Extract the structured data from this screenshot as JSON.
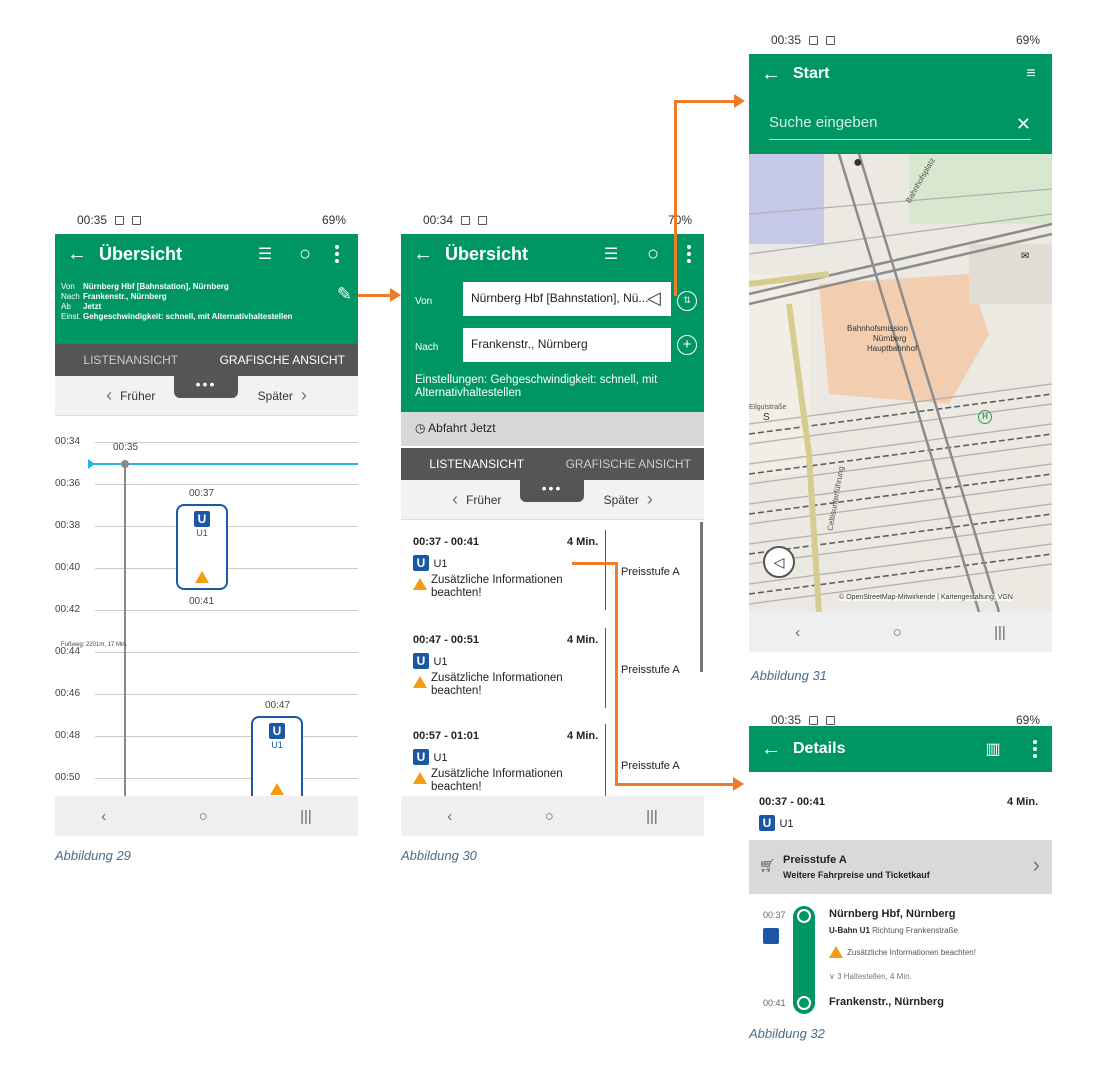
{
  "status": {
    "p29_time": "00:35",
    "p29_right": "69%",
    "p30_time": "00:34",
    "p30_right": "70%",
    "p31_time": "00:35",
    "p31_right": "69%",
    "p32_time": "00:35",
    "p32_right": "69%"
  },
  "p29": {
    "title": "Übersicht",
    "info": [
      {
        "k": "Von",
        "v": "Nürnberg Hbf [Bahnstation], Nürnberg"
      },
      {
        "k": "Nach",
        "v": "Frankenstr., Nürnberg"
      },
      {
        "k": "Ab",
        "v": "Jetzt"
      },
      {
        "k": "Einst.",
        "v": "Gehgeschwindigkeit: schnell, mit Alternativhaltestellen"
      }
    ],
    "tab_list": "LISTENANSICHT",
    "tab_graph": "GRAFISCHE ANSICHT",
    "earlier": "Früher",
    "later": "Später",
    "more": "•••",
    "times": [
      "00:34",
      "00:36",
      "00:38",
      "00:40",
      "00:42",
      "00:44",
      "00:46",
      "00:48",
      "00:50"
    ],
    "now": "00:35",
    "walk": "Fußweg: 2201m, 17 Min.",
    "trip1": {
      "start": "00:37",
      "end": "00:41",
      "line": "U1"
    },
    "trip2": {
      "start": "00:47",
      "line": "U1"
    }
  },
  "p30": {
    "title": "Übersicht",
    "from_label": "Von",
    "from_value": "Nürnberg Hbf [Bahnstation], Nü...",
    "to_label": "Nach",
    "to_value": "Frankenstr., Nürnberg",
    "settings": "Einstellungen: Gehgeschwindigkeit: schnell, mit Alternativhaltestellen",
    "departure": "Abfahrt Jetzt",
    "tab_list": "LISTENANSICHT",
    "tab_graph": "GRAFISCHE ANSICHT",
    "earlier": "Früher",
    "later": "Später",
    "more": "•••",
    "trips": [
      {
        "time": "00:37 - 00:41",
        "dur": "4 Min.",
        "line": "U1",
        "note": "Zusätzliche Informationen beachten!",
        "price": "Preisstufe A"
      },
      {
        "time": "00:47 - 00:51",
        "dur": "4 Min.",
        "line": "U1",
        "note": "Zusätzliche Informationen beachten!",
        "price": "Preisstufe A"
      },
      {
        "time": "00:57 - 01:01",
        "dur": "4 Min.",
        "line": "U1",
        "note": "Zusätzliche Informationen beachten!",
        "price": "Preisstufe A"
      }
    ]
  },
  "p31": {
    "title": "Start",
    "search_placeholder": "Suche eingeben",
    "map_labels": {
      "mission": "Bahnhofsmission",
      "city": "Nürnberg",
      "hbf": "Hauptbahnhof",
      "street1": "Bahnhofsplatz",
      "street2": "Celtisunterführung",
      "street3": "Eilgutstraße",
      "attribution": "© OpenStreetMap-Mitwirkende | Kartengestaltung: VGN",
      "letter": "S",
      "h": "H",
      "frauentor": "Frauentorgr."
    }
  },
  "p32": {
    "title": "Details",
    "time": "00:37 - 00:41",
    "dur": "4 Min.",
    "line": "U1",
    "price_title": "Preisstufe A",
    "price_sub": "Weitere Fahrpreise und Ticketkauf",
    "stop1_time": "00:37",
    "stop1": "Nürnberg Hbf, Nürnberg",
    "line_desc": "U-Bahn U1",
    "direction": "Richtung Frankenstraße",
    "note": "Zusätzliche Informationen beachten!",
    "stops": "3 Haltestellen, 4 Min.",
    "stop2_time": "00:41",
    "stop2": "Frankenstr., Nürnberg"
  },
  "captions": {
    "c29": "Abbildung 29",
    "c30": "Abbildung 30",
    "c31": "Abbildung 31",
    "c32": "Abbildung 32"
  },
  "colors": {
    "green": "#009661",
    "u_blue": "#1a58a6",
    "arrow": "#ee7d2b",
    "warn": "#f39c12"
  }
}
